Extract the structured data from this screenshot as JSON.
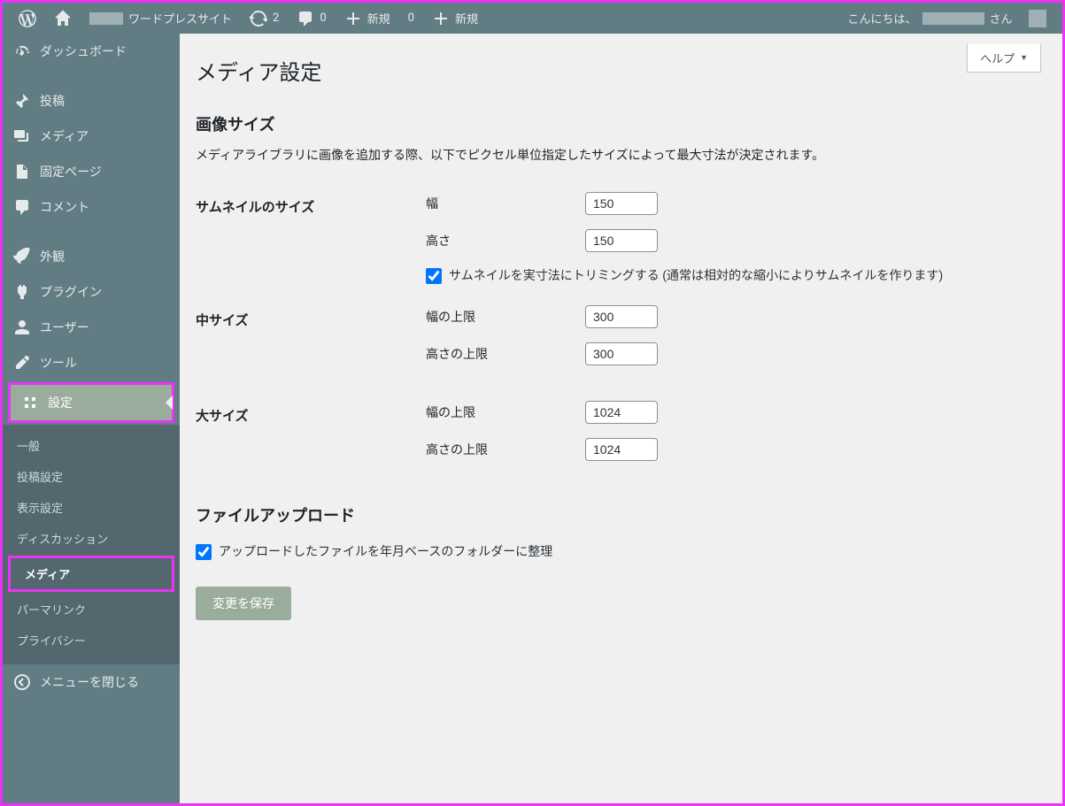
{
  "adminbar": {
    "site_name": "ワードプレスサイト",
    "updates": "2",
    "comments": "0",
    "new_label": "新規",
    "zero": "0",
    "new_label2": "新規",
    "greeting": "こんにちは、",
    "greeting_suffix": "さん"
  },
  "menu": {
    "dashboard": "ダッシュボード",
    "posts": "投稿",
    "media": "メディア",
    "pages": "固定ページ",
    "comments": "コメント",
    "appearance": "外観",
    "plugins": "プラグイン",
    "users": "ユーザー",
    "tools": "ツール",
    "settings": "設定",
    "collapse": "メニューを閉じる"
  },
  "submenu": {
    "general": "一般",
    "writing": "投稿設定",
    "reading": "表示設定",
    "discussion": "ディスカッション",
    "media": "メディア",
    "permalink": "パーマリンク",
    "privacy": "プライバシー"
  },
  "help_label": "ヘルプ",
  "page": {
    "title": "メディア設定",
    "section_image": "画像サイズ",
    "image_desc": "メディアライブラリに画像を追加する際、以下でピクセル単位指定したサイズによって最大寸法が決定されます。",
    "thumb": {
      "label": "サムネイルのサイズ",
      "width_label": "幅",
      "width_value": "150",
      "height_label": "高さ",
      "height_value": "150",
      "crop_label": "サムネイルを実寸法にトリミングする (通常は相対的な縮小によりサムネイルを作ります)"
    },
    "medium": {
      "label": "中サイズ",
      "maxw_label": "幅の上限",
      "maxw_value": "300",
      "maxh_label": "高さの上限",
      "maxh_value": "300"
    },
    "large": {
      "label": "大サイズ",
      "maxw_label": "幅の上限",
      "maxw_value": "1024",
      "maxh_label": "高さの上限",
      "maxh_value": "1024"
    },
    "section_upload": "ファイルアップロード",
    "upload_org_label": "アップロードしたファイルを年月ベースのフォルダーに整理",
    "save_button": "変更を保存"
  }
}
